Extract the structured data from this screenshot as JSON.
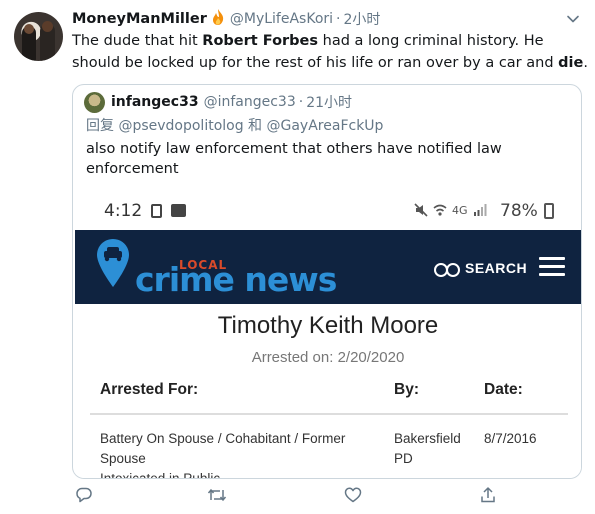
{
  "tweet": {
    "display_name": "MoneyManMiller",
    "handle": "@MyLifeAsKori",
    "dot": "·",
    "time": "2小时",
    "text_part1": "The dude that hit ",
    "text_bold1": "Robert Forbes",
    "text_part2": " had a long criminal history. He should be locked up for the rest of his life or ran over by a car and ",
    "text_bold2": "die",
    "text_part3": "."
  },
  "quoted_tweet": {
    "display_name": "infangec33",
    "handle": "@infangec33",
    "dot": "·",
    "time": "21小时",
    "reply_line": "回复 @psevdopolitolog 和 @GayAreaFckUp",
    "text": "also notify law enforcement that others have notified law enforcement"
  },
  "phone_screenshot": {
    "status_time": "4:12",
    "status_network": "4G",
    "battery": "78%",
    "logo_local": "LOCAL",
    "logo_main": "crime news",
    "search_label": "SEARCH",
    "person_name": "Timothy Keith Moore",
    "arrested_on": "Arrested on: 2/20/2020",
    "table_headers": [
      "Arrested For:",
      "By:",
      "Date:"
    ],
    "row1": {
      "charge_line1": "Battery On Spouse / Cohabitant / Former",
      "charge_line2": "Spouse",
      "charge_line3": "Intoxicated in Public",
      "by_line1": "Bakersfield",
      "by_line2": "PD",
      "date": "8/7/2016"
    },
    "brand_colors": {
      "banner": "#0f2340",
      "logo_blue": "#2c8fd6",
      "logo_red": "#d94a2a"
    }
  },
  "icons": {
    "fire": "fire-icon",
    "chevron": "chevron-down-icon",
    "reply": "reply-icon",
    "retweet": "retweet-icon",
    "like": "heart-icon",
    "share": "share-icon"
  }
}
